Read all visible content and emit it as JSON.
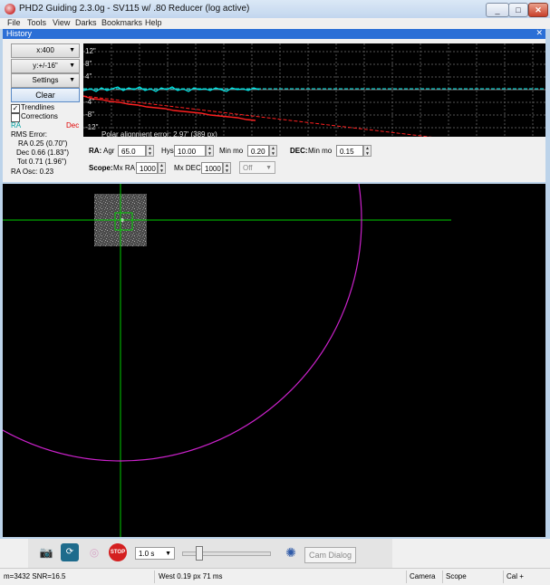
{
  "window": {
    "title": "PHD2 Guiding 2.3.0g - SV115 w/ .80 Reducer (log active)",
    "controls": {
      "minimize": "_",
      "maximize": "□",
      "close": "✕"
    }
  },
  "menu": [
    "File",
    "Tools",
    "View",
    "Darks",
    "Bookmarks",
    "Help"
  ],
  "history": {
    "title": "History",
    "close_glyph": "✕",
    "x_scale": "x:400",
    "y_scale": "y:+/-16\"",
    "settings_label": "Settings",
    "clear_label": "Clear",
    "trendlines": {
      "label": "Trendlines",
      "checked": true
    },
    "corrections": {
      "label": "Corrections",
      "checked": false
    },
    "ra_legend": "RA",
    "dec_legend": "Dec",
    "rms_label": "RMS Error:",
    "rms_ra": "RA 0.25 (0.70\")",
    "rms_dec": "Dec 0.66 (1.83\")",
    "rms_tot": "Tot 0.71 (1.96\")",
    "ra_osc": "RA Osc: 0.23",
    "graph": {
      "y_labels": [
        "12\"",
        "8\"",
        "4\"",
        "-4\"",
        "-8\"",
        "-12\""
      ],
      "polar_alignment": "Polar alignment error: 2.97' (389 px)",
      "ra_color": "#00e5e5",
      "dec_color": "#ff2020"
    }
  },
  "params": {
    "ra_label": "RA:",
    "agr_label": "Agr",
    "agr_value": "65.0",
    "hys_label": "Hys",
    "hys_value": "10.00",
    "minmo_label": "Min mo",
    "ra_minmo_value": "0.20",
    "dec_label": "DEC:",
    "dec_minmo_label": "Min mo",
    "dec_minmo_value": "0.15",
    "scope_label": "Scope:",
    "mxra_label": "Mx RA",
    "mxra_value": "1000",
    "mxdec_label": "Mx DEC",
    "mxdec_value": "1000",
    "dec_mode": "Off"
  },
  "toolbar": {
    "exposure": "1.0 s",
    "stop_label": "STOP",
    "cam_dialog": "Cam Dialog"
  },
  "status": {
    "star": "m=3432 SNR=16.5",
    "guide": "West  0.19 px  71 ms",
    "camera": "Camera",
    "scope": "Scope",
    "cal": "Cal +"
  },
  "icons": {
    "camera": "camera-icon",
    "loop": "loop-icon",
    "guide": "guide-target-icon",
    "stop": "stop-icon",
    "brain": "brain-icon"
  },
  "colors": {
    "crosshair": "#00cc00",
    "circle": "#cc22cc",
    "ra_line": "#00e5e5",
    "dec_line": "#ff2020"
  }
}
